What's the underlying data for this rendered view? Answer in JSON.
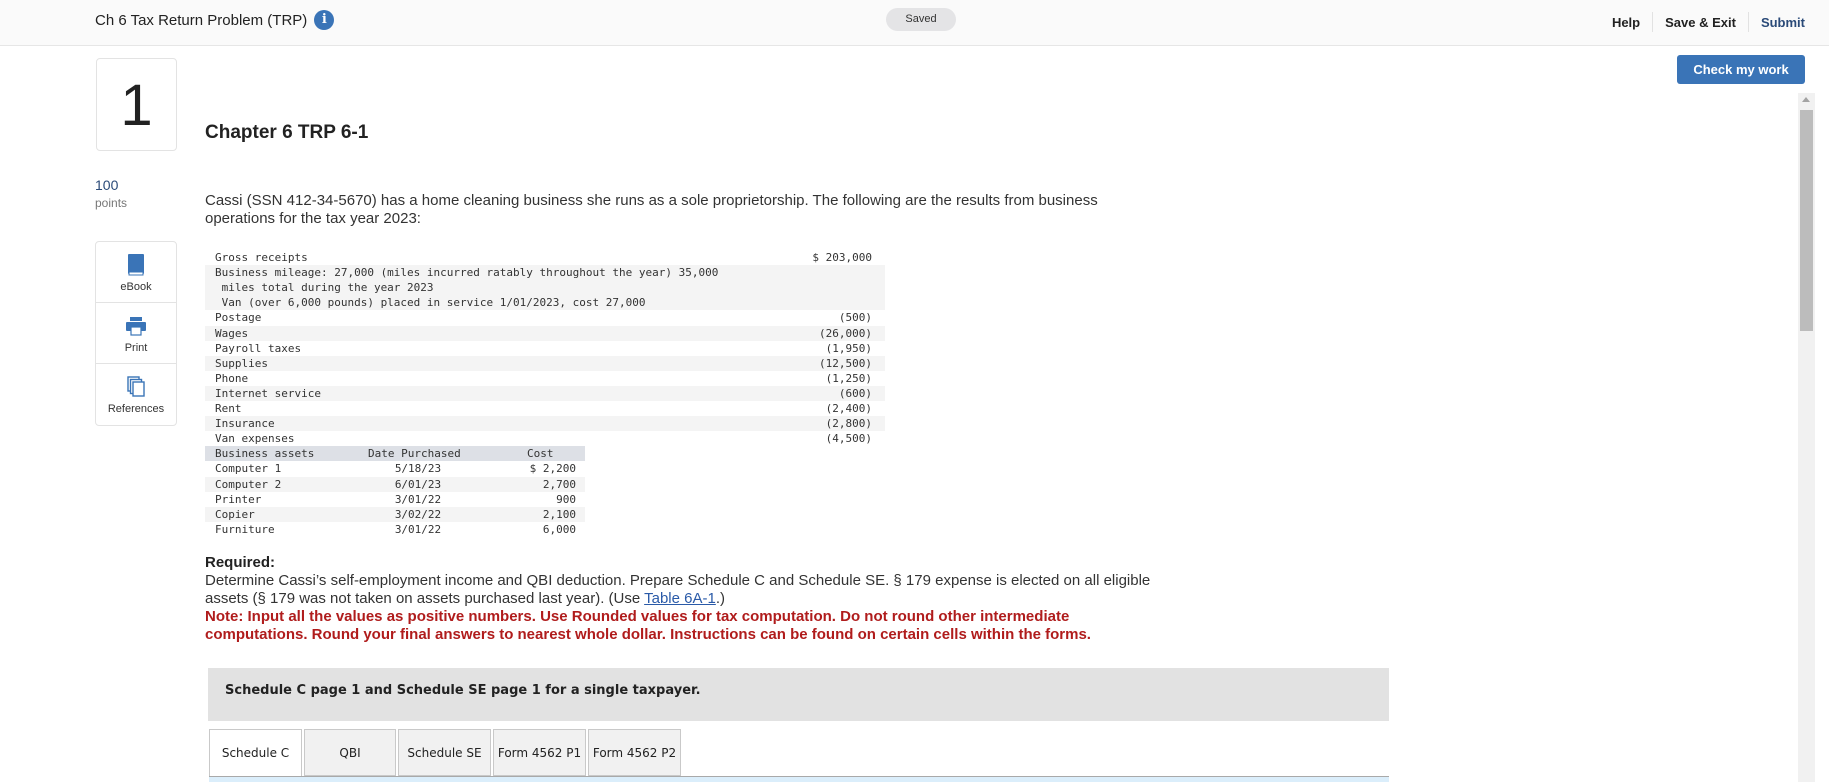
{
  "header": {
    "title": "Ch 6 Tax Return Problem (TRP)",
    "info_icon": "info-icon",
    "status": "Saved",
    "links": {
      "help": "Help",
      "save_exit": "Save & Exit",
      "submit": "Submit"
    },
    "check_button": "Check my work"
  },
  "question": {
    "number": "1",
    "points": "100",
    "points_label": "points",
    "title": "Chapter 6 TRP 6-1"
  },
  "tools": [
    {
      "icon": "book-icon",
      "label": "eBook"
    },
    {
      "icon": "print-icon",
      "label": "Print"
    },
    {
      "icon": "references-icon",
      "label": "References"
    }
  ],
  "intro": "Cassi (SSN 412-34-5670) has a home cleaning business she runs as a sole proprietorship. The following are the results from business operations for the tax year 2023:",
  "operations": [
    {
      "label": "Gross receipts",
      "amount": "$ 203,000"
    },
    {
      "label": "Business mileage: 27,000 (miles incurred ratably throughout the year) 35,000",
      "amount": ""
    },
    {
      "label": " miles total during the year 2023",
      "amount": ""
    },
    {
      "label": " Van (over 6,000 pounds) placed in service 1/01/2023, cost 27,000",
      "amount": ""
    },
    {
      "label": "Postage",
      "amount": "(500)"
    },
    {
      "label": "Wages",
      "amount": "(26,000)"
    },
    {
      "label": "Payroll taxes",
      "amount": "(1,950)"
    },
    {
      "label": "Supplies",
      "amount": "(12,500)"
    },
    {
      "label": "Phone",
      "amount": "(1,250)"
    },
    {
      "label": "Internet service",
      "amount": "(600)"
    },
    {
      "label": "Rent",
      "amount": "(2,400)"
    },
    {
      "label": "Insurance",
      "amount": "(2,800)"
    },
    {
      "label": "Van expenses",
      "amount": "(4,500)"
    }
  ],
  "assets": {
    "headers": [
      "Business assets",
      "Date Purchased",
      "Cost"
    ],
    "rows": [
      [
        "Computer 1",
        "5/18/23",
        "$ 2,200"
      ],
      [
        "Computer 2",
        "6/01/23",
        "2,700"
      ],
      [
        "Printer",
        "3/01/22",
        "900"
      ],
      [
        "Copier",
        "3/02/22",
        "2,100"
      ],
      [
        "Furniture",
        "3/01/22",
        "6,000"
      ]
    ]
  },
  "required": {
    "title": "Required:",
    "text_before_link": "Determine Cassi’s self-employment income and QBI deduction. Prepare Schedule C and Schedule SE. § 179 expense is elected on all eligible assets (§ 179 was not taken on assets purchased last year). (Use ",
    "link": "Table 6A-1",
    "text_after_link": ".)",
    "note": "Note: Input all the values as positive numbers. Use Rounded values for tax computation. Do not round other intermediate computations. Round your final answers to nearest whole dollar. Instructions can be found on certain cells within the forms."
  },
  "schedule_banner": "Schedule C page 1 and Schedule SE page 1 for a single taxpayer.",
  "tabs": [
    {
      "label": "Schedule C",
      "active": true
    },
    {
      "label": "QBI",
      "active": false
    },
    {
      "label": "Schedule SE",
      "active": false
    },
    {
      "label": "Form 4562 P1",
      "active": false
    },
    {
      "label": "Form 4562 P2",
      "active": false
    }
  ]
}
